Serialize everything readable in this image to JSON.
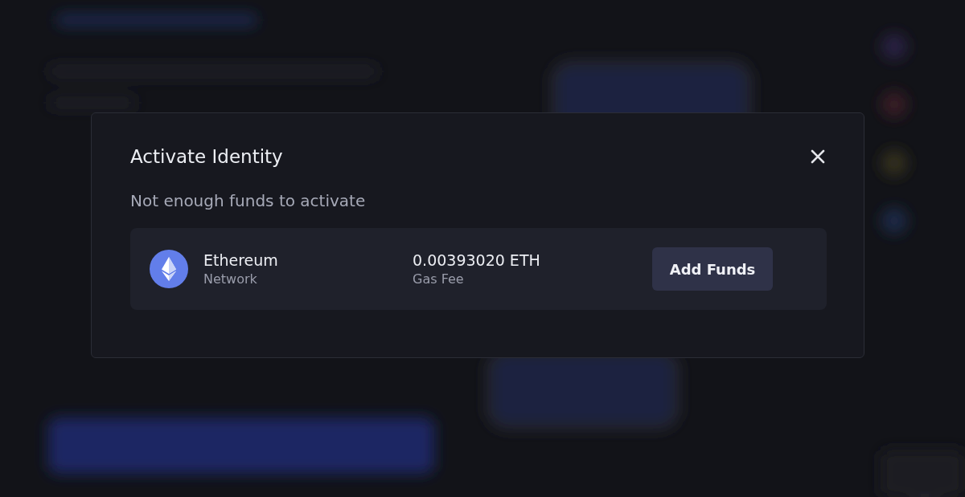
{
  "dialog": {
    "title": "Activate Identity",
    "message": "Not enough funds to activate",
    "fee_card": {
      "network_name": "Ethereum",
      "network_label": "Network",
      "amount": "0.00393020 ETH",
      "amount_label": "Gas Fee",
      "button": "Add Funds"
    }
  }
}
